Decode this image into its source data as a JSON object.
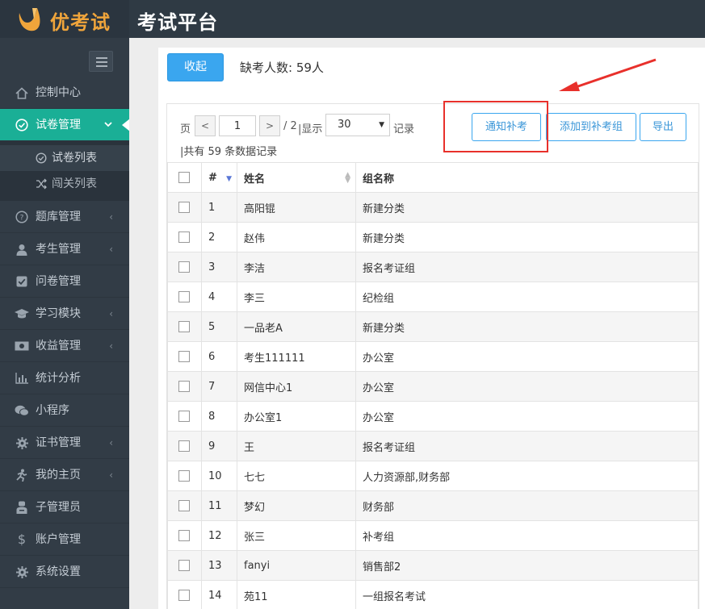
{
  "header": {
    "brand": "优考试",
    "title": "考试平台"
  },
  "colors": {
    "topbar": "#2f3a44",
    "sidebar": "#323c46",
    "active": "#1aaf96",
    "primary": "#3aa6ef",
    "highlight": "#e8302b",
    "brand": "#f0a53b"
  },
  "sidebar": {
    "items": [
      {
        "label": "控制中心",
        "icon": "home-icon",
        "chevron": false
      },
      {
        "label": "试卷管理",
        "icon": "check-circle-icon",
        "chevron": true,
        "active": true
      },
      {
        "label": "题库管理",
        "icon": "question-circle-icon",
        "chevron": true
      },
      {
        "label": "考生管理",
        "icon": "user-icon",
        "chevron": true
      },
      {
        "label": "问卷管理",
        "icon": "checkbox-icon",
        "chevron": false
      },
      {
        "label": "学习模块",
        "icon": "graduation-cap-icon",
        "chevron": true
      },
      {
        "label": "收益管理",
        "icon": "money-icon",
        "chevron": true
      },
      {
        "label": "统计分析",
        "icon": "bar-chart-icon",
        "chevron": false
      },
      {
        "label": "小程序",
        "icon": "wechat-icon",
        "chevron": false
      },
      {
        "label": "证书管理",
        "icon": "gear-icon",
        "chevron": true
      },
      {
        "label": "我的主页",
        "icon": "person-run-icon",
        "chevron": true
      },
      {
        "label": "子管理员",
        "icon": "admin-icon",
        "chevron": false
      },
      {
        "label": "账户管理",
        "icon": "dollar-icon",
        "chevron": false
      },
      {
        "label": "系统设置",
        "icon": "settings-icon",
        "chevron": false
      }
    ],
    "submenu": [
      {
        "label": "试卷列表",
        "icon": "check-circle-icon",
        "current": true
      },
      {
        "label": "闯关列表",
        "icon": "shuffle-icon",
        "current": false
      }
    ]
  },
  "toolbar": {
    "collapse_label": "收起",
    "absent_text": "缺考人数: 59人"
  },
  "pager": {
    "page_label": "页",
    "page_value": "1",
    "page_total": "/ 2",
    "show_label": "|显示",
    "page_size": "30",
    "records_label": "记录",
    "total_text": "|共有 59 条数据记录"
  },
  "actions": {
    "notify": "通知补考",
    "add_group": "添加到补考组",
    "export": "导出"
  },
  "table": {
    "headers": {
      "num": "#",
      "name": "姓名",
      "group": "组名称"
    },
    "rows": [
      {
        "num": "1",
        "name": "高阳锟",
        "group": "新建分类"
      },
      {
        "num": "2",
        "name": "赵伟",
        "group": "新建分类"
      },
      {
        "num": "3",
        "name": "李洁",
        "group": "报名考证组"
      },
      {
        "num": "4",
        "name": "李三",
        "group": "纪检组"
      },
      {
        "num": "5",
        "name": "一品老A",
        "group": "新建分类"
      },
      {
        "num": "6",
        "name": "考生111111",
        "group": "办公室"
      },
      {
        "num": "7",
        "name": "网信中心1",
        "group": "办公室"
      },
      {
        "num": "8",
        "name": "办公室1",
        "group": "办公室"
      },
      {
        "num": "9",
        "name": "王",
        "group": "报名考证组"
      },
      {
        "num": "10",
        "name": "七七",
        "group": "人力资源部,财务部"
      },
      {
        "num": "11",
        "name": "梦幻",
        "group": "财务部"
      },
      {
        "num": "12",
        "name": "张三",
        "group": "补考组"
      },
      {
        "num": "13",
        "name": "fanyi",
        "group": "销售部2"
      },
      {
        "num": "14",
        "name": "苑11",
        "group": "一组报名考试"
      }
    ]
  }
}
